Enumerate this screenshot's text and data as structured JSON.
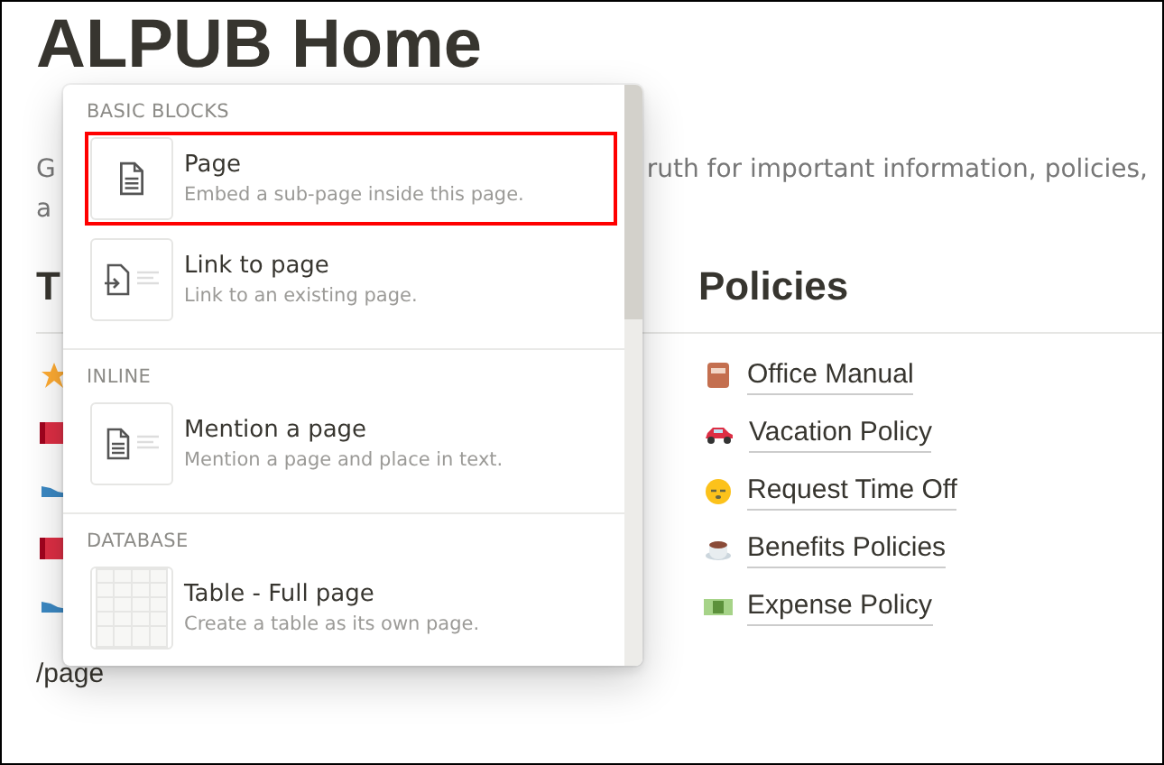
{
  "page": {
    "title": "ALPUB Home",
    "description_start": "G",
    "description_end": "ruth for important information, policies,",
    "description_line2": "a",
    "left_heading": "T",
    "right_heading": "Policies",
    "right_items": [
      {
        "label": "Office Manual"
      },
      {
        "label": "Vacation Policy"
      },
      {
        "label": "Request Time Off"
      },
      {
        "label": "Benefits Policies"
      },
      {
        "label": "Expense Policy"
      }
    ],
    "command": "/page"
  },
  "menu": {
    "sections": [
      {
        "header": "BASIC BLOCKS",
        "items": [
          {
            "title": "Page",
            "description": "Embed a sub-page inside this page.",
            "highlighted": true
          },
          {
            "title": "Link to page",
            "description": "Link to an existing page.",
            "highlighted": false
          }
        ]
      },
      {
        "header": "INLINE",
        "items": [
          {
            "title": "Mention a page",
            "description": "Mention a page and place in text.",
            "highlighted": false
          }
        ]
      },
      {
        "header": "DATABASE",
        "items": [
          {
            "title": "Table - Full page",
            "description": "Create a table as its own page.",
            "highlighted": false
          }
        ]
      }
    ]
  }
}
